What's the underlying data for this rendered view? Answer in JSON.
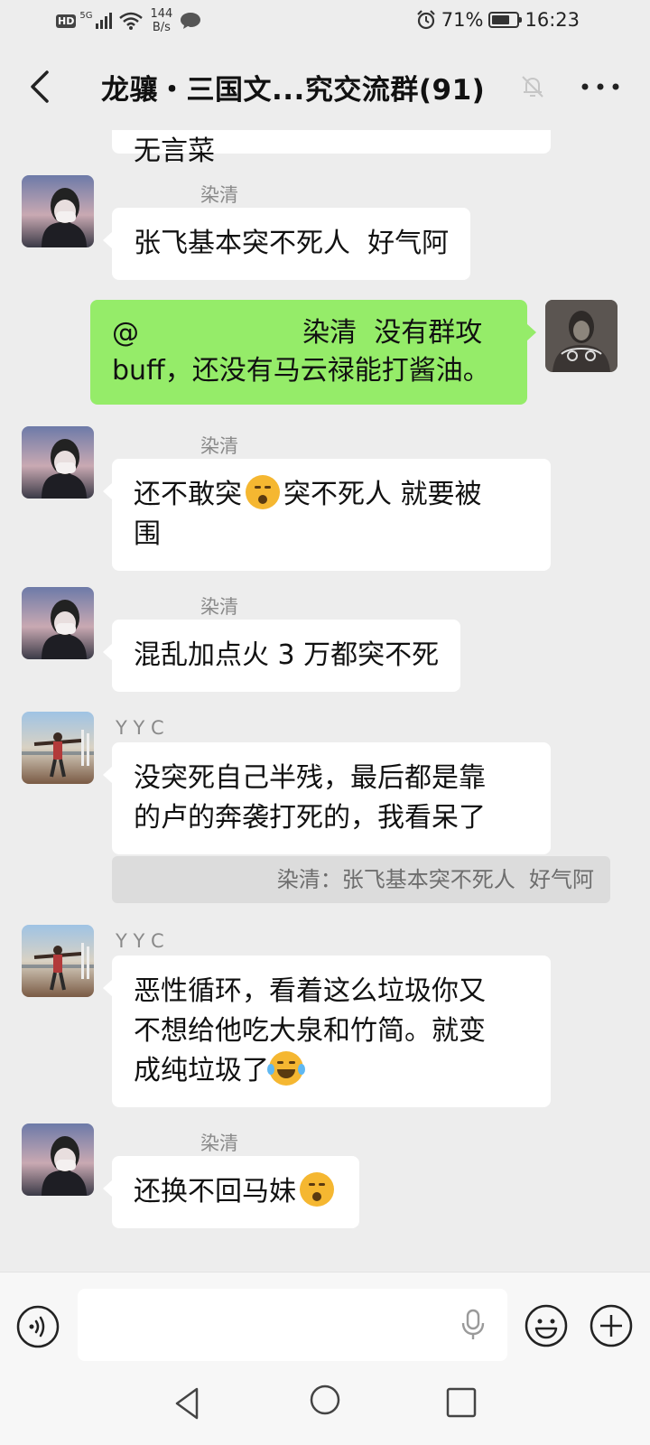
{
  "status_bar": {
    "hd": "HD",
    "network": "5G",
    "net_speed_value": "144",
    "net_speed_unit": "B/s",
    "battery_percent": "71%",
    "battery_level": 0.71,
    "time": "16:23"
  },
  "nav": {
    "title": "龙骧・三国文...究交流群(91)"
  },
  "messages": {
    "partial_top": {
      "text": "无言菜"
    },
    "m1": {
      "sender": "染清",
      "text": "张飞基本突不死人  好气阿"
    },
    "m2": {
      "line1": "@                   染清  没有群攻",
      "line2": "buff，还没有马云禄能打酱油。"
    },
    "m3": {
      "sender": "染清",
      "line1_a": "还不敢突",
      "line1_b": "突不死人 就要被",
      "line2": "围"
    },
    "m4": {
      "sender": "染清",
      "text": "混乱加点火 3 万都突不死"
    },
    "m5": {
      "sender": "Y Y C",
      "line1": "没突死自己半残，最后都是靠",
      "line2": "的卢的奔袭打死的，我看呆了",
      "quote": "染清：张飞基本突不死人  好气阿"
    },
    "m6": {
      "sender": "Y Y C",
      "line1": "恶性循环，看着这么垃圾你又",
      "line2": "不想给他吃大泉和竹简。就变",
      "line3": "成纯垃圾了"
    },
    "m7": {
      "sender": "染清",
      "text": "还换不回马妹"
    }
  },
  "input": {
    "value": "",
    "placeholder": ""
  },
  "colors": {
    "background": "#ededed",
    "bubble_self": "#95ec69",
    "bubble_other": "#ffffff"
  }
}
